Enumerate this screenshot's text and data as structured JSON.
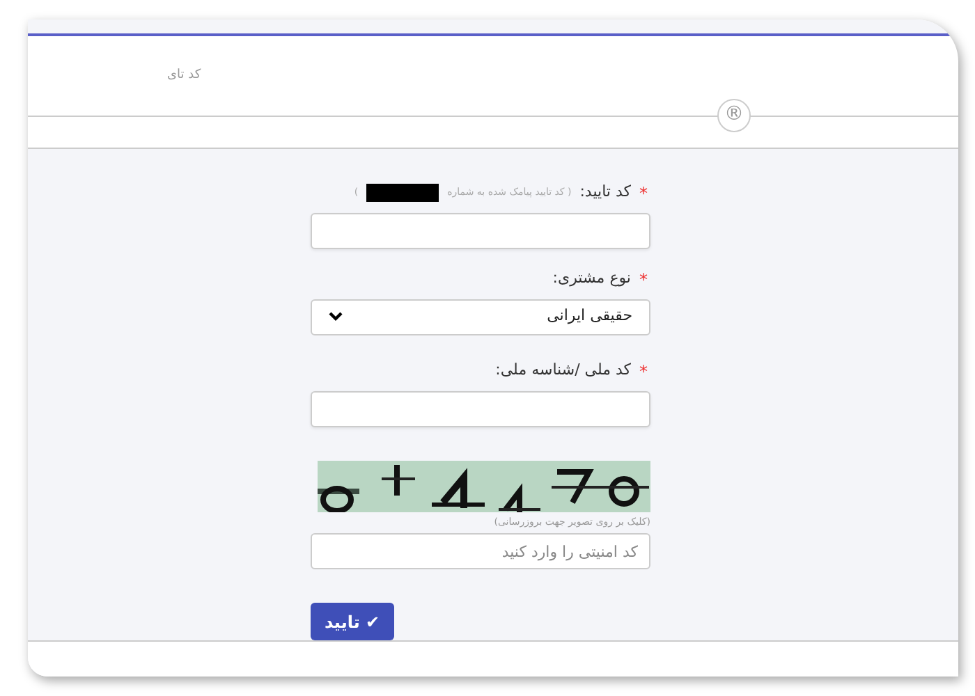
{
  "header": {
    "title": "کد تای",
    "mark": "®"
  },
  "fields": [
    {
      "kind": "text",
      "label": "کد تایید:",
      "hint": "( کد تایید پیامک شده به شماره",
      "hint_end": ")",
      "redacted": true,
      "required": true
    },
    {
      "kind": "select",
      "label": "نوع مشتری:",
      "required": true,
      "value": "حقیقی ایرانی"
    },
    {
      "kind": "text",
      "label": "کد ملی /شناسه ملی:",
      "required": true
    },
    {
      "kind": "captcha",
      "caption": "(کلیک بر روی تصویر جهت بروزرسانی)",
      "placeholder": "کد امنیتی را وارد کنید"
    }
  ],
  "submit": {
    "label": "تایید",
    "icon": "✔"
  },
  "required_mark": "*"
}
